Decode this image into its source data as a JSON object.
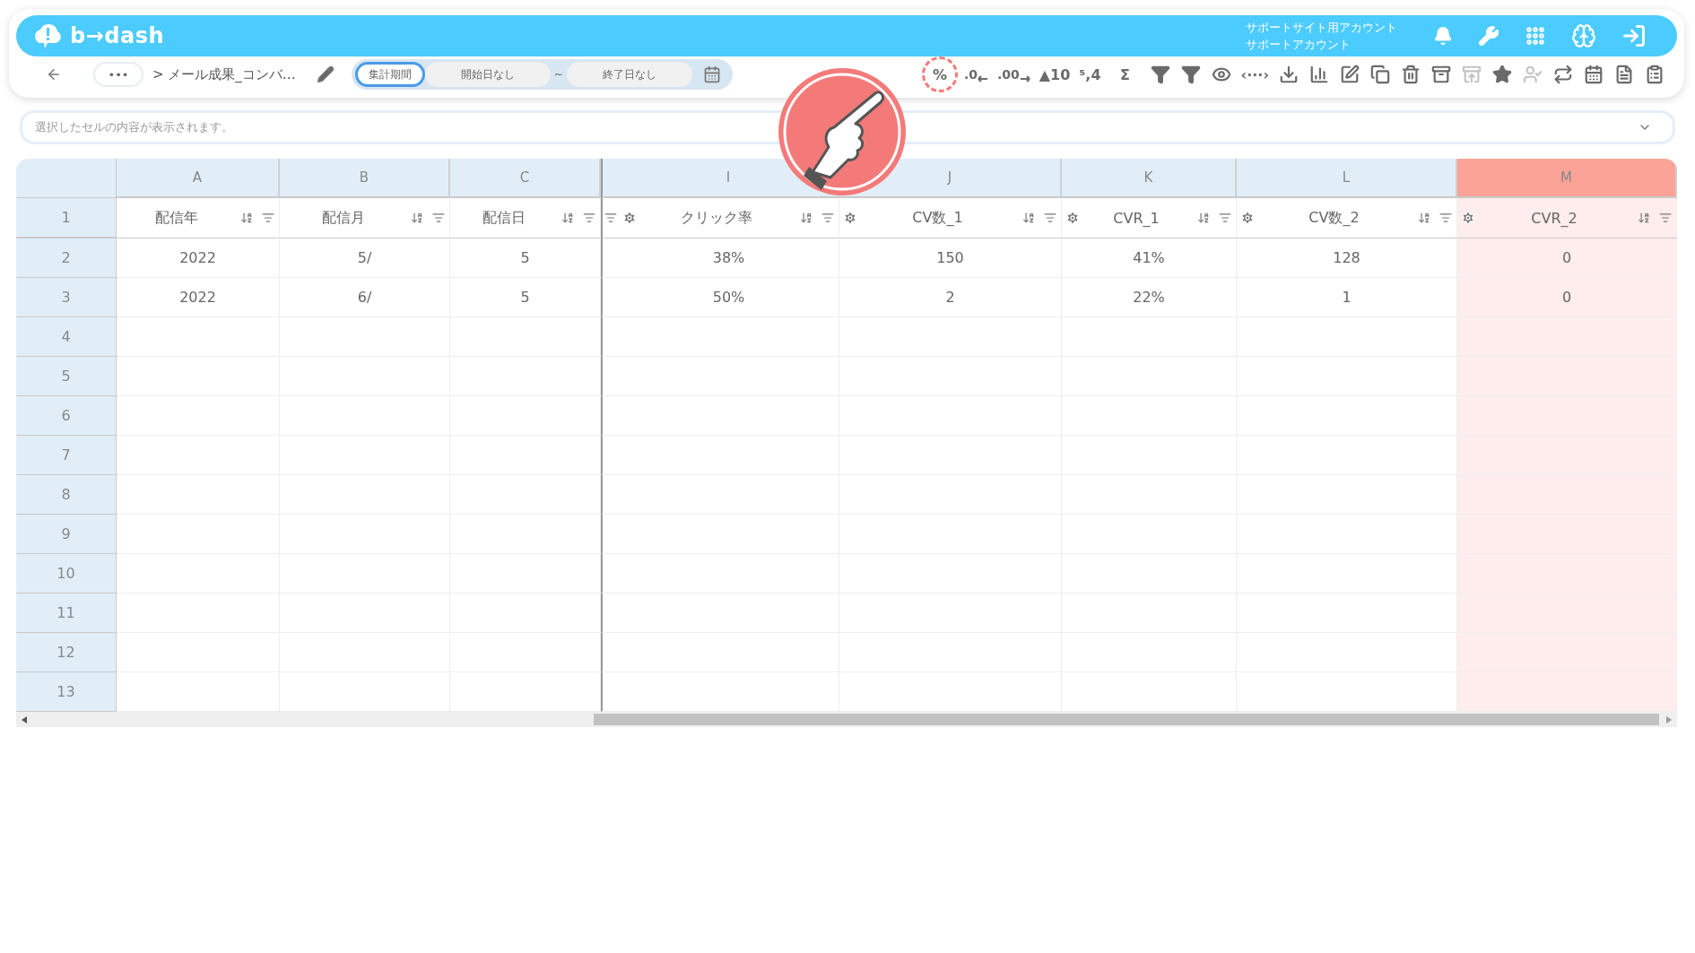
{
  "header": {
    "logo": "b→dash",
    "account_lines": [
      "サポートサイト用アカウント",
      "サポートアカウント"
    ]
  },
  "toolbar": {
    "more": "•••",
    "breadcrumb": "> メール成果_コンバ…",
    "period": {
      "label": "集計期間",
      "start": "開始日なし",
      "separator": "~",
      "end": "終了日なし"
    },
    "buttons": [
      {
        "kind": "text",
        "label": "%",
        "disabled": false,
        "highlighted": true
      },
      {
        "kind": "less",
        "label": ".0",
        "disabled": false,
        "highlighted": false
      },
      {
        "kind": "more",
        "label": ".00",
        "disabled": false,
        "highlighted": false
      },
      {
        "kind": "text",
        "label": "▲10",
        "disabled": false,
        "highlighted": false
      },
      {
        "kind": "text",
        "label": "⁵,4",
        "disabled": false,
        "highlighted": false
      },
      {
        "kind": "text",
        "label": "Σ",
        "disabled": false,
        "highlighted": false
      },
      {
        "kind": "userfilter",
        "disabled": false,
        "highlighted": false
      },
      {
        "kind": "filter",
        "disabled": false,
        "highlighted": false
      },
      {
        "kind": "eye",
        "disabled": false,
        "highlighted": false
      },
      {
        "kind": "text",
        "label": "‹···›",
        "disabled": false,
        "highlighted": false
      },
      {
        "kind": "download",
        "disabled": false,
        "highlighted": false
      },
      {
        "kind": "chart",
        "disabled": false,
        "highlighted": false
      },
      {
        "kind": "edit",
        "disabled": false,
        "highlighted": false
      },
      {
        "kind": "copy",
        "disabled": false,
        "highlighted": false
      },
      {
        "kind": "trash",
        "disabled": false,
        "highlighted": false
      },
      {
        "kind": "archivedown",
        "disabled": false,
        "highlighted": false
      },
      {
        "kind": "archiveup",
        "disabled": true,
        "highlighted": false
      },
      {
        "kind": "star",
        "disabled": false,
        "highlighted": false
      },
      {
        "kind": "usercheck",
        "disabled": true,
        "highlighted": false
      },
      {
        "kind": "repeat",
        "disabled": false,
        "highlighted": false
      },
      {
        "kind": "calendar",
        "disabled": false,
        "highlighted": false
      },
      {
        "kind": "file",
        "disabled": false,
        "highlighted": false
      },
      {
        "kind": "clipboard",
        "disabled": false,
        "highlighted": false
      }
    ]
  },
  "formula_bar": {
    "placeholder": "選択したセルの内容が表示されます。"
  },
  "sheet": {
    "header_row_number": "1",
    "columns": [
      {
        "letter": "A",
        "name": "配信年",
        "selected": false,
        "gear": false
      },
      {
        "letter": "B",
        "name": "配信月",
        "selected": false,
        "gear": false
      },
      {
        "letter": "C",
        "name": "配信日",
        "selected": false,
        "gear": false
      },
      {
        "letter": "I",
        "name": "クリック率",
        "selected": false,
        "gear": true
      },
      {
        "letter": "J",
        "name": "CV数_1",
        "selected": false,
        "gear": true
      },
      {
        "letter": "K",
        "name": "CVR_1",
        "selected": false,
        "gear": true
      },
      {
        "letter": "L",
        "name": "CV数_2",
        "selected": false,
        "gear": true
      },
      {
        "letter": "M",
        "name": "CVR_2",
        "selected": true,
        "gear": true
      }
    ],
    "rows": [
      {
        "number": "2",
        "cells": [
          "2022",
          "5/",
          "5",
          "38%",
          "150",
          "41%",
          "128",
          "0"
        ]
      },
      {
        "number": "3",
        "cells": [
          "2022",
          "6/",
          "5",
          "50%",
          "2",
          "22%",
          "1",
          "0"
        ]
      },
      {
        "number": "4",
        "cells": []
      },
      {
        "number": "5",
        "cells": []
      },
      {
        "number": "6",
        "cells": []
      },
      {
        "number": "7",
        "cells": []
      },
      {
        "number": "8",
        "cells": []
      },
      {
        "number": "9",
        "cells": []
      },
      {
        "number": "10",
        "cells": []
      },
      {
        "number": "11",
        "cells": []
      },
      {
        "number": "12",
        "cells": []
      },
      {
        "number": "13",
        "cells": []
      }
    ]
  }
}
